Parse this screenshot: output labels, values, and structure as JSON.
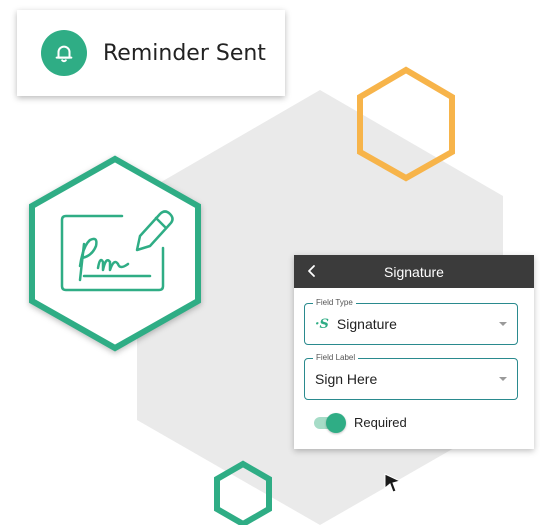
{
  "reminder": {
    "icon": "bell-icon",
    "text": "Reminder Sent"
  },
  "signature_panel": {
    "title": "Signature",
    "back_icon": "chevron-left-icon",
    "field_type": {
      "label": "Field Type",
      "value": "Signature",
      "icon": "signature-icon"
    },
    "field_label": {
      "label": "Field Label",
      "value": "Sign Here"
    },
    "required": {
      "label": "Required",
      "checked": true
    }
  },
  "colors": {
    "accent": "#2fad85",
    "hex_orange": "#f7b44a",
    "hex_gray": "#eaeaea",
    "header_dark": "#3b3b3b",
    "field_border": "#2a8a8e"
  },
  "decorations": {
    "large_hex": "gray-hexagon",
    "orange_hex": "orange-hexagon-outline",
    "green_hex": "green-hexagon-outline",
    "signature_badge": "signature-pen-icon"
  }
}
